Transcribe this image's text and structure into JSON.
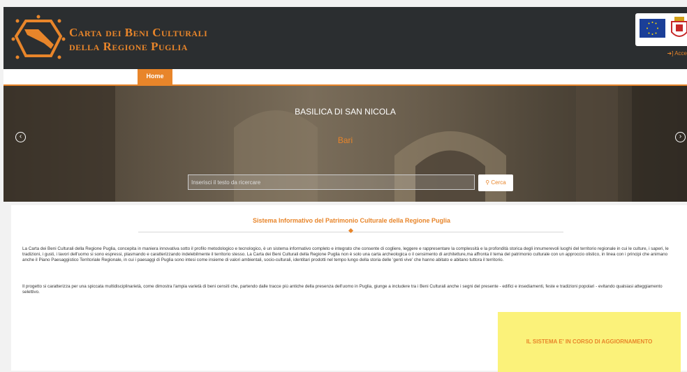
{
  "header": {
    "brand_line1": "Carta dei Beni Culturali",
    "brand_line2": "della Regione Puglia",
    "access_label": "Acce"
  },
  "nav": {
    "home": "Home"
  },
  "hero": {
    "title": "BASILICA DI SAN NICOLA",
    "subtitle": "Bari",
    "search_placeholder": "Inserisci il testo da ricercare",
    "search_button": "Cerca",
    "prev_icon": "chevron-left-icon",
    "next_icon": "chevron-right-icon"
  },
  "content": {
    "title": "Sistema Informativo del Patrimonio Culturale della Regione Puglia",
    "paragraph1": "La Carta dei Beni Culturali della Regione Puglia, concepita in maniera innovativa sotto il profilo metodologico e tecnologico, è un sistema informativo completo e integrato che consente di cogliere, leggere e rappresentare la complessità e la profondità storica degli innumerevoli luoghi del territorio regionale in cui le culture, i saperi, le tradizioni, i gusti, i lavori dell'uomo si sono espressi, plasmando e caratterizzando indelebilmente il territorio stesso. La Carta dei Beni Culturali della Regione Puglia non è solo una carta archeologica o il censimento di architetture,ma affronta il tema del patrimonio culturale con un approccio olistico, in linea con i principi che animano anche il Piano Paesaggistico Territoriale Regionale, in cui i paesaggi di Puglia sono intesi come insieme di valori ambientali, socio-culturali, identitari prodotti nel tempo lungo della storia delle 'genti vive' che hanno abitato e abitano tuttora il territorio.",
    "paragraph2": "Il progetto si caratterizza per una spiccata multidisciplinarietà, come dimostra l'ampia varietà di beni censiti che, partendo dalle tracce più antiche della presenza dell'uomo in Puglia, giunge a includere tra i Beni Culturali anche i segni del presente - edifici e insediamenti, feste e tradizioni popolari - evitando qualsiasi atteggiamento selettivo.",
    "notice": "IL SISTEMA E' IN CORSO DI AGGIORNAMENTO"
  },
  "colors": {
    "accent": "#e8852a",
    "header_bg": "#2b2e30",
    "notice_bg": "#fbf27a"
  }
}
